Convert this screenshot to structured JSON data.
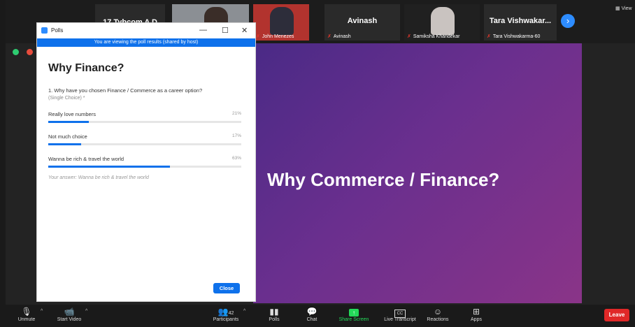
{
  "meeting": {
    "participants_strip": [
      {
        "name": "17 Tybcom A D",
        "label": ""
      },
      {
        "name": "",
        "label": ""
      },
      {
        "name": "",
        "label": "John Menezes"
      },
      {
        "name": "Avinash",
        "label": "Avinash"
      },
      {
        "name": "",
        "label": "Samiksha Khandekar"
      },
      {
        "name": "Tara Vishwakar...",
        "label": "Tara Vishwakarma-60"
      }
    ],
    "view_label": "View",
    "next_icon": "chevron-right-icon"
  },
  "polls": {
    "window_title": "Polls",
    "minimize": "—",
    "maximize": "☐",
    "close": "✕",
    "banner": "You are viewing the poll results (shared by host)",
    "heading": "Why Finance?",
    "question": "1. Why have you chosen Finance / Commerce as a career option?",
    "question_type": "(Single Choice) *",
    "options": [
      {
        "label": "Really love numbers",
        "percent": "21%",
        "value": 21
      },
      {
        "label": "Not much choice",
        "percent": "17%",
        "value": 17
      },
      {
        "label": "Wanna be rich & travel the world",
        "percent": "63%",
        "value": 63
      }
    ],
    "your_answer": "Your answer: Wanna be rich & travel the world",
    "close_button": "Close"
  },
  "slide": {
    "title": "Why Commerce / Finance?"
  },
  "toolbar": {
    "unmute": "Unmute",
    "start_video": "Start Video",
    "participants": "Participants",
    "participants_count": "42",
    "polls": "Polls",
    "chat": "Chat",
    "share_screen": "Share Screen",
    "live_transcript": "Live Transcript",
    "reactions": "Reactions",
    "apps": "Apps",
    "leave": "Leave",
    "colors": {
      "share": "#23d959",
      "leave": "#e02828",
      "accent": "#0e71eb"
    }
  }
}
